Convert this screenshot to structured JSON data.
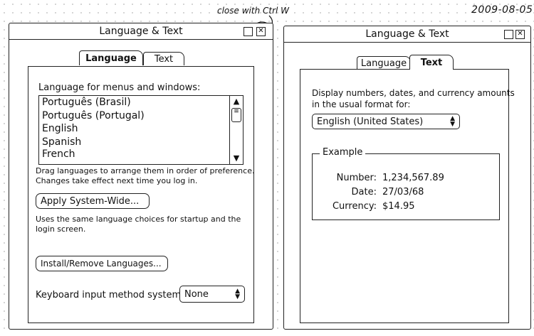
{
  "date": "2009-08-05",
  "annotation": "close with Ctrl W",
  "left_window": {
    "title": "Language & Text",
    "tabs": [
      "Language",
      "Text"
    ],
    "list_label": "Language for menus and windows:",
    "languages": [
      "Português (Brasil)",
      "Português (Portugal)",
      "English",
      "Spanish",
      "French"
    ],
    "drag_hint_1": "Drag languages to arrange them in order of preference.",
    "drag_hint_2": "Changes take effect next time you log in.",
    "apply_button": "Apply System-Wide...",
    "apply_desc_1": "Uses the same language choices for startup and the",
    "apply_desc_2": "login screen.",
    "install_button": "Install/Remove Languages...",
    "keyboard_label": "Keyboard input method system:",
    "keyboard_value": "None"
  },
  "right_window": {
    "title": "Language & Text",
    "tabs": [
      "Language",
      "Text"
    ],
    "format_label_1": "Display numbers, dates, and currency amounts",
    "format_label_2": "in the usual format for:",
    "format_value": "English (United States)",
    "example_title": "Example",
    "example": {
      "number_label": "Number:",
      "number_value": "1,234,567.89",
      "date_label": "Date:",
      "date_value": "27/03/68",
      "currency_label": "Currency:",
      "currency_value": "$14.95"
    }
  }
}
